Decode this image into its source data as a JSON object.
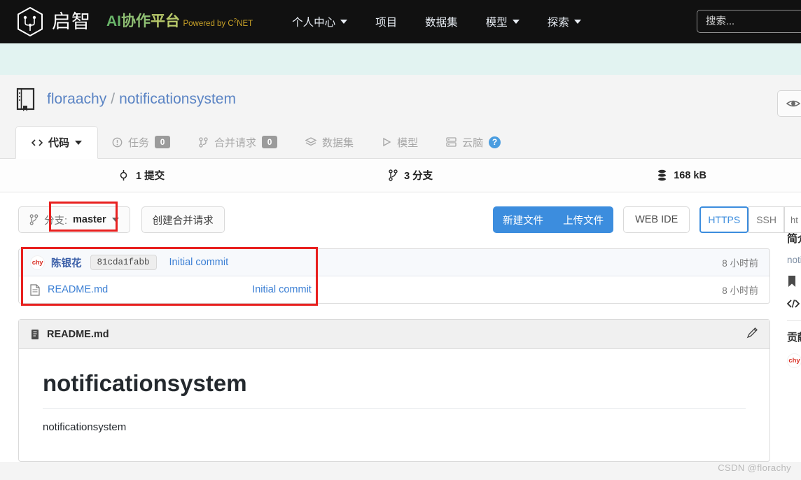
{
  "header": {
    "brand_cn": "启智",
    "brand_ai_1": "AI",
    "brand_ai_2": "协作",
    "brand_ai_3": "平台",
    "brand_sub_pre": "Powered by C",
    "brand_sub_sup": "2",
    "brand_sub_post": "NET",
    "nav": [
      {
        "label": "个人中心",
        "has_caret": true
      },
      {
        "label": "项目",
        "has_caret": false
      },
      {
        "label": "数据集",
        "has_caret": false
      },
      {
        "label": "模型",
        "has_caret": true
      },
      {
        "label": "探索",
        "has_caret": true
      }
    ],
    "search_placeholder": "搜索..."
  },
  "repo": {
    "owner": "floraachy",
    "separator": "/",
    "name": "notificationsystem"
  },
  "tabs": [
    {
      "label": "代码",
      "badge": null,
      "active": true,
      "caret": true,
      "icon": "code-icon"
    },
    {
      "label": "任务",
      "badge": "0",
      "active": false,
      "caret": false,
      "icon": "issue-icon"
    },
    {
      "label": "合并请求",
      "badge": "0",
      "active": false,
      "caret": false,
      "icon": "pull-request-icon"
    },
    {
      "label": "数据集",
      "badge": null,
      "active": false,
      "caret": false,
      "icon": "dataset-icon"
    },
    {
      "label": "模型",
      "badge": null,
      "active": false,
      "caret": false,
      "icon": "model-icon"
    },
    {
      "label": "云脑",
      "badge": null,
      "active": false,
      "caret": false,
      "icon": "cloudbrain-icon",
      "help": "?"
    }
  ],
  "stats": {
    "commits": "1 提交",
    "branches": "3 分支",
    "size": "168 kB"
  },
  "actions": {
    "branch_label": "分支:",
    "branch_value": "master",
    "create_pr": "创建合并请求",
    "new_file": "新建文件",
    "upload_file": "上传文件",
    "web_ide": "WEB IDE",
    "https": "HTTPS",
    "ssh": "SSH",
    "clone_url": "ht"
  },
  "commit_row": {
    "avatar_initials": "chy",
    "author": "陈银花",
    "hash": "81cda1fabb",
    "message": "Initial commit",
    "time": "8 小时前"
  },
  "files": [
    {
      "name": "README.md",
      "commit_message": "Initial commit",
      "time": "8 小时前",
      "icon": "file-icon"
    }
  ],
  "readme": {
    "filename": "README.md",
    "heading": "notificationsystem",
    "body": "notificationsystem"
  },
  "sidebar": {
    "intro_title": "简介",
    "intro_desc": "noti",
    "contrib_title": "贡献",
    "contrib_avatar": "chy"
  },
  "watermark": "CSDN @florachy",
  "colors": {
    "header_bg": "#111111",
    "mint_band": "#e2f3f1",
    "link_blue": "#3b7fd4",
    "primary_blue": "#3c8dde",
    "annotation_red": "#e8201f",
    "brand_green": "#69b469",
    "brand_gold": "#c9a227"
  }
}
